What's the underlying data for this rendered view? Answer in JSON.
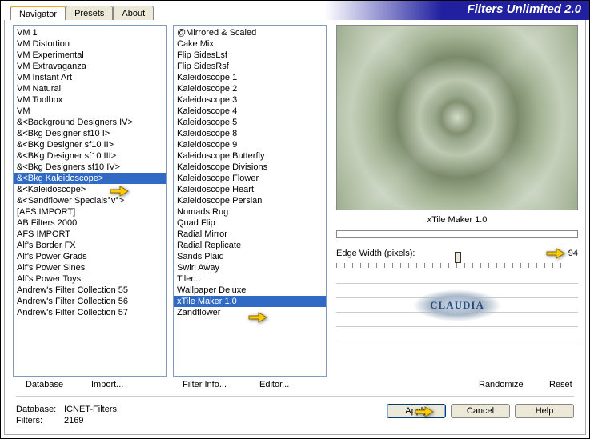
{
  "app": {
    "title": "Filters Unlimited 2.0"
  },
  "tabs": {
    "navigator": "Navigator",
    "presets": "Presets",
    "about": "About"
  },
  "col1": [
    "VM 1",
    "VM Distortion",
    "VM Experimental",
    "VM Extravaganza",
    "VM Instant Art",
    "VM Natural",
    "VM Toolbox",
    "VM",
    "&<Background Designers IV>",
    "&<Bkg Designer sf10 I>",
    "&<BKg Designer sf10 II>",
    "&<BKg Designer sf10 III>",
    "&<Bkg Designers sf10 IV>",
    "&<Bkg Kaleidoscope>",
    "&<Kaleidoscope>",
    "&<Sandflower Specials°v°>",
    "[AFS IMPORT]",
    "AB Filters 2000",
    "AFS IMPORT",
    "Alf's Border FX",
    "Alf's Power Grads",
    "Alf's Power Sines",
    "Alf's Power Toys",
    "Andrew's Filter Collection 55",
    "Andrew's Filter Collection 56",
    "Andrew's Filter Collection 57"
  ],
  "col1_selected": 13,
  "col2": [
    "@Mirrored & Scaled",
    "Cake Mix",
    "Flip SidesLsf",
    "Flip SidesRsf",
    "Kaleidoscope 1",
    "Kaleidoscope 2",
    "Kaleidoscope 3",
    "Kaleidoscope 4",
    "Kaleidoscope 5",
    "Kaleidoscope 8",
    "Kaleidoscope 9",
    "Kaleidoscope Butterfly",
    "Kaleidoscope Divisions",
    "Kaleidoscope Flower",
    "Kaleidoscope Heart",
    "Kaleidoscope Persian",
    "Nomads Rug",
    "Quad Flip",
    "Radial Mirror",
    "Radial Replicate",
    "Sands Plaid",
    "Swirl Away",
    "Tiler...",
    "Wallpaper Deluxe",
    "xTile Maker 1.0",
    "Zandflower"
  ],
  "col2_selected": 24,
  "preview_label": "xTile Maker 1.0",
  "slider": {
    "label": "Edge Width (pixels):",
    "value": "94"
  },
  "watermark": "CLAUDIA",
  "buttons_flat": {
    "database": "Database",
    "import": "Import...",
    "filter_info": "Filter Info...",
    "editor": "Editor...",
    "randomize": "Randomize",
    "reset": "Reset"
  },
  "footer": {
    "db_label": "Database:",
    "db_value": "ICNET-Filters",
    "filters_label": "Filters:",
    "filters_value": "2169"
  },
  "buttons": {
    "apply": "Apply",
    "cancel": "Cancel",
    "help": "Help"
  }
}
